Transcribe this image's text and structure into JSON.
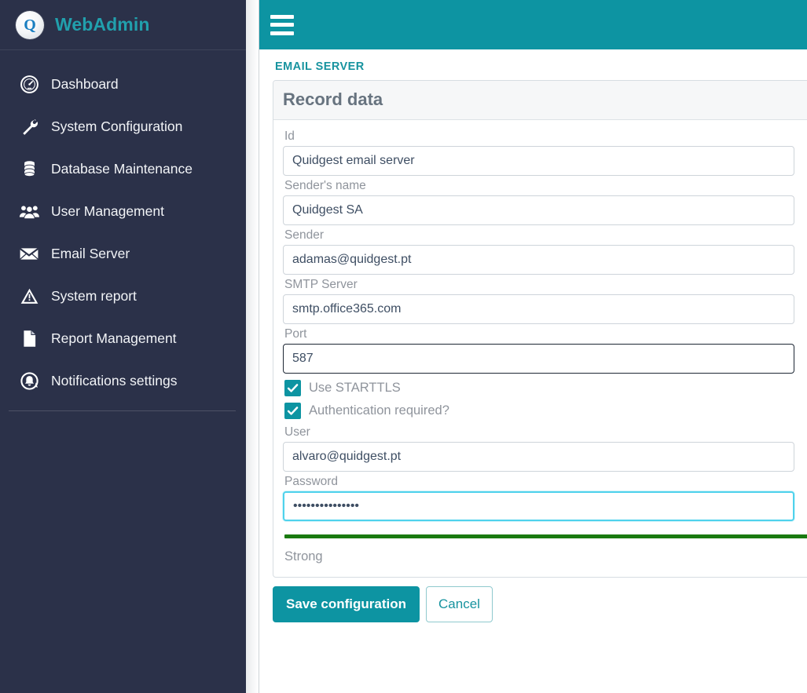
{
  "brand": {
    "logo_icon": "q-logo-icon",
    "logo_letter": "Q",
    "title": "WebAdmin",
    "navy": "#2b3149",
    "accent": "#0d94a2",
    "brand_text_color": "#21a0ad"
  },
  "sidebar": {
    "items": [
      {
        "label": "Dashboard",
        "icon": "gauge-icon"
      },
      {
        "label": "System Configuration",
        "icon": "wrench-icon"
      },
      {
        "label": "Database Maintenance",
        "icon": "database-icon"
      },
      {
        "label": "User Management",
        "icon": "users-icon"
      },
      {
        "label": "Email Server",
        "icon": "envelope-icon"
      },
      {
        "label": "System report",
        "icon": "warning-triangle-icon"
      },
      {
        "label": "Report Management",
        "icon": "document-page-icon"
      },
      {
        "label": "Notifications settings",
        "icon": "bell-circle-icon"
      }
    ]
  },
  "topbar": {
    "menu_toggle_icon": "hamburger-icon",
    "background": "#0d94a2"
  },
  "breadcrumb": "EMAIL SERVER",
  "card": {
    "title": "Record data",
    "fields": [
      {
        "label": "Id",
        "value": "Quidgest email server",
        "placeholder": "",
        "state": "normal",
        "name": "id-field"
      },
      {
        "label": "Sender's name",
        "value": "Quidgest SA",
        "placeholder": "",
        "state": "normal",
        "name": "sender-name-field"
      },
      {
        "label": "Sender",
        "value": "adamas@quidgest.pt",
        "placeholder": "",
        "state": "normal",
        "name": "sender-field"
      },
      {
        "label": "SMTP Server",
        "value": "smtp.office365.com",
        "placeholder": "",
        "state": "normal",
        "name": "smtp-server-field"
      },
      {
        "label": "Port",
        "value": "587",
        "placeholder": "",
        "state": "hover",
        "name": "port-field"
      }
    ],
    "checkboxes": [
      {
        "label": "Use STARTTLS",
        "checked": true,
        "name": "use-starttls-checkbox"
      },
      {
        "label": "Authentication required?",
        "checked": true,
        "name": "authentication-required-checkbox"
      }
    ],
    "user_field": {
      "label": "User",
      "value": "alvaro@quidgest.pt",
      "placeholder": ""
    },
    "password_field": {
      "label": "Password",
      "value": "•••••••••••••••",
      "placeholder": ""
    },
    "password_strength": {
      "text": "Strong",
      "color": "#1a7a10",
      "percent": 100
    }
  },
  "actions": {
    "save_label": "Save configuration",
    "cancel_label": "Cancel"
  }
}
